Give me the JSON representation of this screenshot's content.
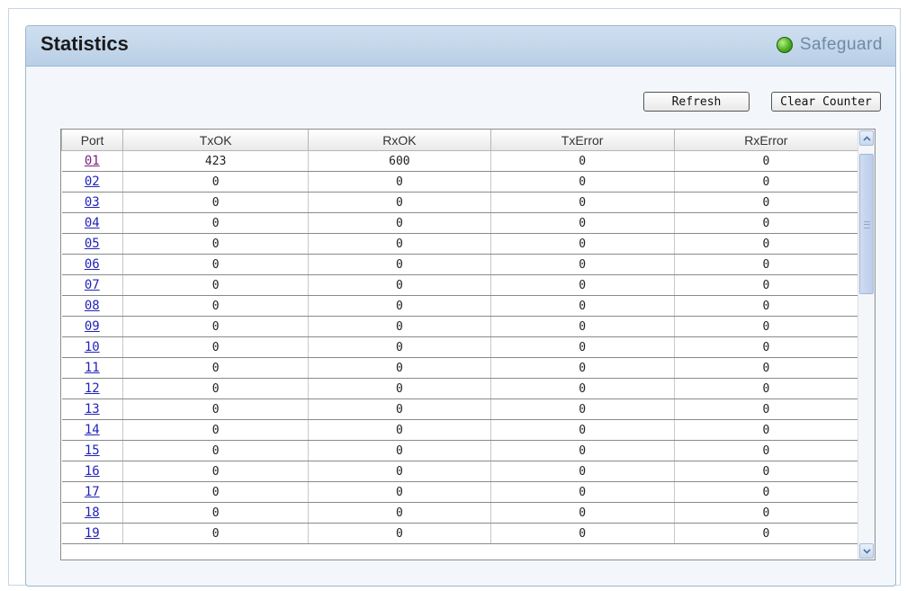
{
  "page": {
    "title": "Statistics",
    "brand": "Safeguard"
  },
  "toolbar": {
    "refresh_label": "Refresh",
    "clear_label": "Clear Counter"
  },
  "table": {
    "headers": [
      "Port",
      "TxOK",
      "RxOK",
      "TxError",
      "RxError"
    ],
    "rows": [
      {
        "port": "01",
        "txok": "423",
        "rxok": "600",
        "txerror": "0",
        "rxerror": "0"
      },
      {
        "port": "02",
        "txok": "0",
        "rxok": "0",
        "txerror": "0",
        "rxerror": "0"
      },
      {
        "port": "03",
        "txok": "0",
        "rxok": "0",
        "txerror": "0",
        "rxerror": "0"
      },
      {
        "port": "04",
        "txok": "0",
        "rxok": "0",
        "txerror": "0",
        "rxerror": "0"
      },
      {
        "port": "05",
        "txok": "0",
        "rxok": "0",
        "txerror": "0",
        "rxerror": "0"
      },
      {
        "port": "06",
        "txok": "0",
        "rxok": "0",
        "txerror": "0",
        "rxerror": "0"
      },
      {
        "port": "07",
        "txok": "0",
        "rxok": "0",
        "txerror": "0",
        "rxerror": "0"
      },
      {
        "port": "08",
        "txok": "0",
        "rxok": "0",
        "txerror": "0",
        "rxerror": "0"
      },
      {
        "port": "09",
        "txok": "0",
        "rxok": "0",
        "txerror": "0",
        "rxerror": "0"
      },
      {
        "port": "10",
        "txok": "0",
        "rxok": "0",
        "txerror": "0",
        "rxerror": "0"
      },
      {
        "port": "11",
        "txok": "0",
        "rxok": "0",
        "txerror": "0",
        "rxerror": "0"
      },
      {
        "port": "12",
        "txok": "0",
        "rxok": "0",
        "txerror": "0",
        "rxerror": "0"
      },
      {
        "port": "13",
        "txok": "0",
        "rxok": "0",
        "txerror": "0",
        "rxerror": "0"
      },
      {
        "port": "14",
        "txok": "0",
        "rxok": "0",
        "txerror": "0",
        "rxerror": "0"
      },
      {
        "port": "15",
        "txok": "0",
        "rxok": "0",
        "txerror": "0",
        "rxerror": "0"
      },
      {
        "port": "16",
        "txok": "0",
        "rxok": "0",
        "txerror": "0",
        "rxerror": "0"
      },
      {
        "port": "17",
        "txok": "0",
        "rxok": "0",
        "txerror": "0",
        "rxerror": "0"
      },
      {
        "port": "18",
        "txok": "0",
        "rxok": "0",
        "txerror": "0",
        "rxerror": "0"
      },
      {
        "port": "19",
        "txok": "0",
        "rxok": "0",
        "txerror": "0",
        "rxerror": "0"
      }
    ]
  },
  "icons": {
    "status": "green-status-light-icon",
    "scroll_up": "chevron-up-icon",
    "scroll_down": "chevron-down-icon"
  },
  "colors": {
    "link": "#2323b8",
    "visited_link": "#7a1f7a",
    "titlebar": "#c4d7eb",
    "status_green": "#4fae21"
  }
}
